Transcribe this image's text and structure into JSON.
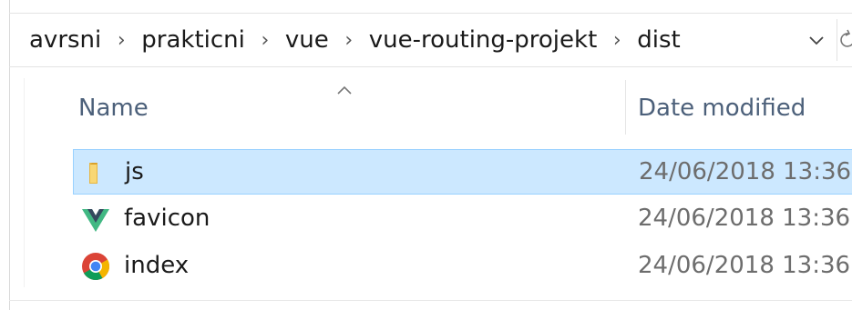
{
  "address_bar": {
    "crumbs": [
      "avrsni",
      "prakticni",
      "vue",
      "vue-routing-projekt",
      "dist"
    ],
    "separator": "›",
    "dropdown_icon": "chevron-down-icon",
    "refresh_icon": "refresh-icon"
  },
  "columns": {
    "name": "Name",
    "date_modified": "Date modified",
    "sort_indicator": "^"
  },
  "files": [
    {
      "name": "js",
      "date": "24/06/2018 13:36",
      "icon": "folder-icon",
      "selected": true
    },
    {
      "name": "favicon",
      "date": "24/06/2018 13:36",
      "icon": "vue-logo-icon",
      "selected": false
    },
    {
      "name": "index",
      "date": "24/06/2018 13:36",
      "icon": "chrome-icon",
      "selected": false
    }
  ],
  "colors": {
    "selection_bg": "#cce8ff",
    "selection_border": "#99d1ff",
    "header_text": "#4c607a",
    "date_text": "#6d6d6d"
  }
}
